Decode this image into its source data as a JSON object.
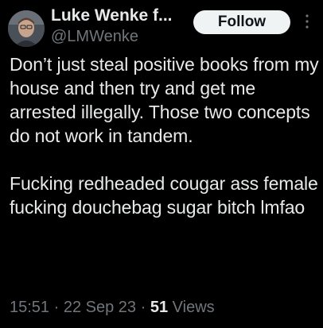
{
  "author": {
    "display_name": "Luke Wenke f...",
    "handle": "@LMWenke"
  },
  "follow_button_label": "Follow",
  "more_icon": "more-vertical-icon",
  "tweet": {
    "text": "Don’t just steal positive books from my house and then try and get me arrested illegally.  Those two concepts do not work in tandem.\n\nFucking redheaded cougar ass female fucking douchebag sugar bitch lmfao"
  },
  "meta": {
    "time": "15:51",
    "separator": "·",
    "date": "22 Sep 23",
    "views_count": "51",
    "views_label": "Views"
  },
  "colors": {
    "background": "#000000",
    "primary_text": "#e7e9ea",
    "secondary_text": "#71767b",
    "button_bg": "#eff3f4",
    "button_text": "#0f1419"
  }
}
